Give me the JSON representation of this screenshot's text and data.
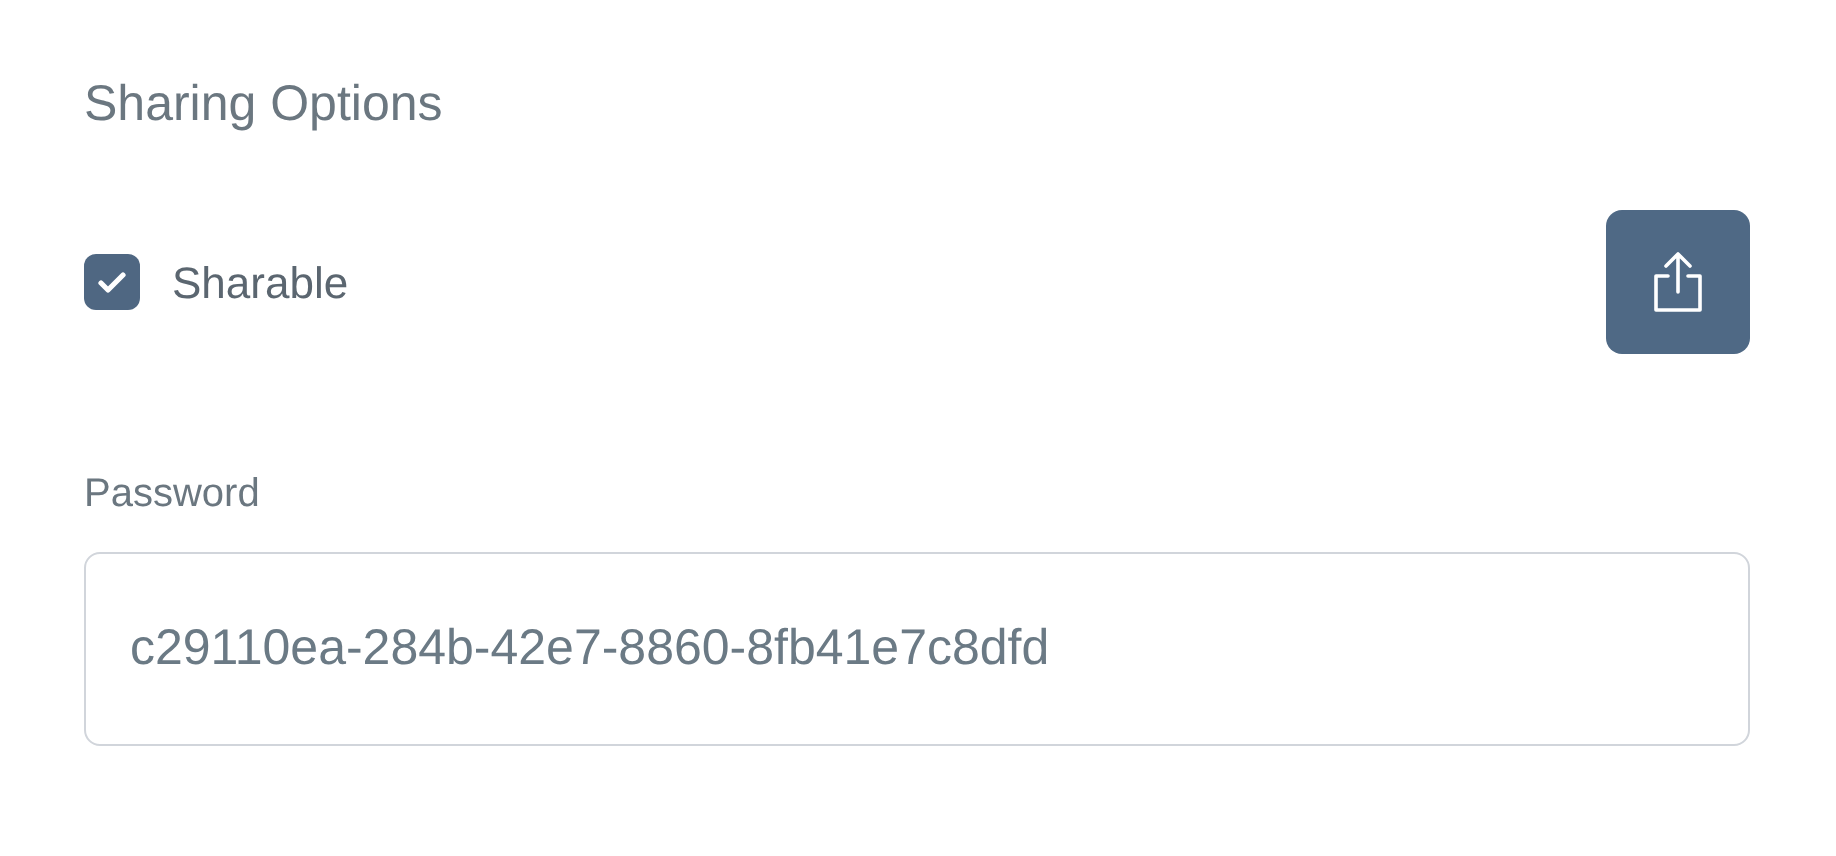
{
  "section": {
    "title": "Sharing Options"
  },
  "sharable": {
    "label": "Sharable",
    "checked": true
  },
  "password": {
    "label": "Password",
    "value": "c29110ea-284b-42e7-8860-8fb41e7c8dfd"
  }
}
